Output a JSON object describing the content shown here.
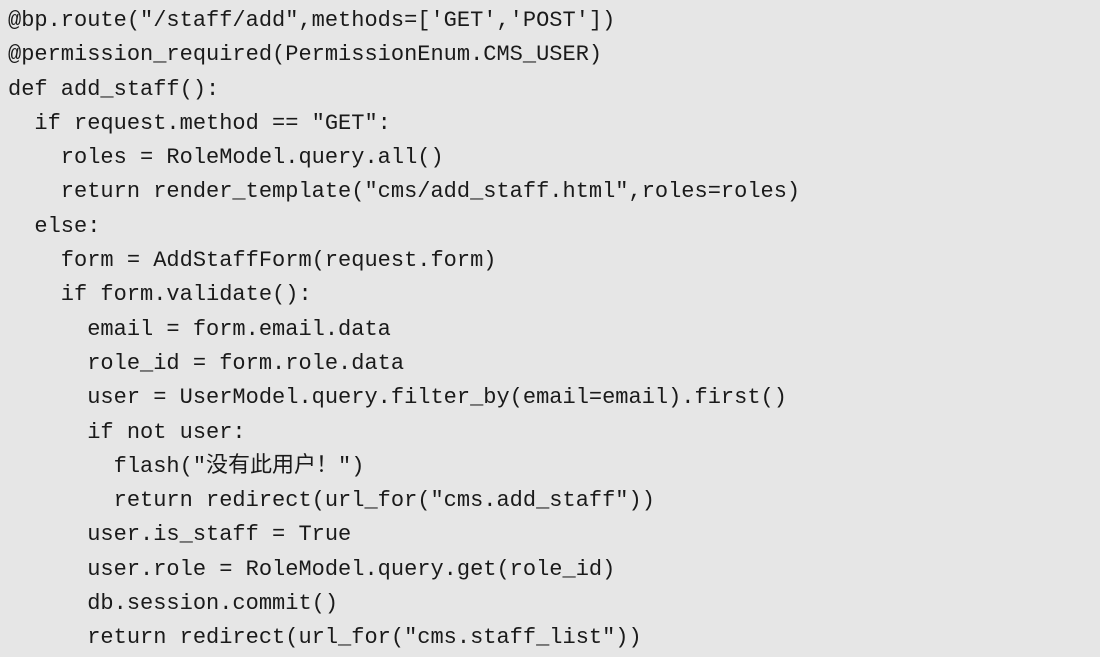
{
  "code": {
    "lines": [
      "@bp.route(\"/staff/add\",methods=['GET','POST'])",
      "@permission_required(PermissionEnum.CMS_USER)",
      "def add_staff():",
      "  if request.method == \"GET\":",
      "    roles = RoleModel.query.all()",
      "    return render_template(\"cms/add_staff.html\",roles=roles)",
      "  else:",
      "    form = AddStaffForm(request.form)",
      "    if form.validate():",
      "      email = form.email.data",
      "      role_id = form.role.data",
      "      user = UserModel.query.filter_by(email=email).first()",
      "      if not user:",
      "        flash(\"没有此用户！\")",
      "        return redirect(url_for(\"cms.add_staff\"))",
      "      user.is_staff = True",
      "      user.role = RoleModel.query.get(role_id)",
      "      db.session.commit()",
      "      return redirect(url_for(\"cms.staff_list\"))"
    ]
  }
}
